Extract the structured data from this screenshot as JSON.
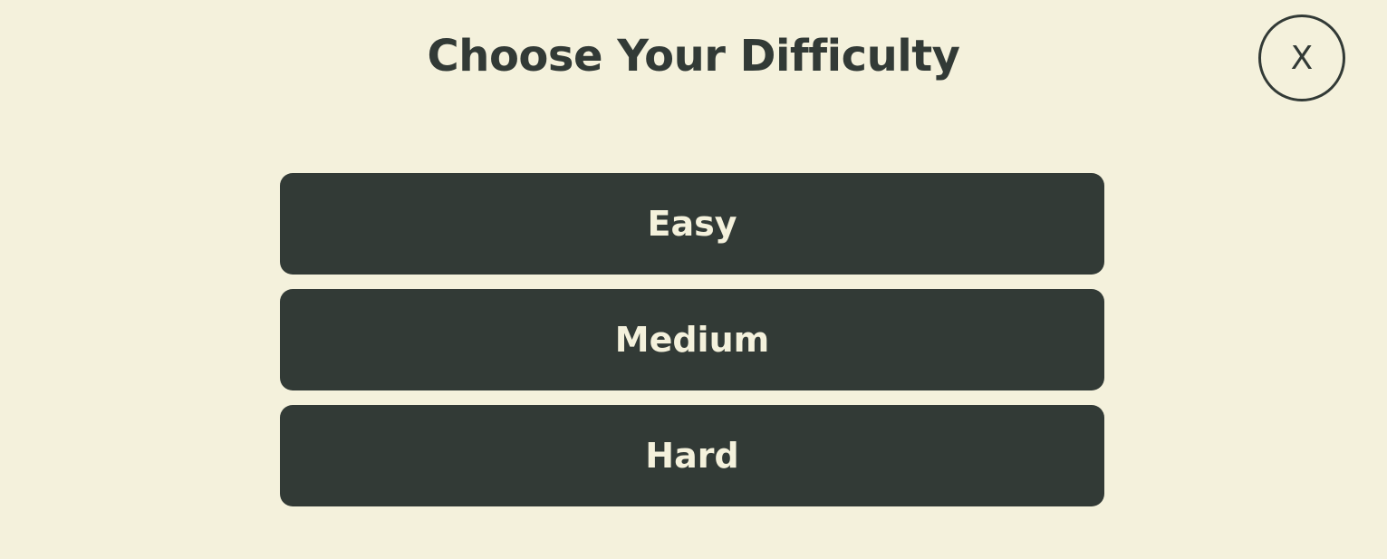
{
  "dialog": {
    "title": "Choose Your Difficulty",
    "close_label": "X",
    "options": [
      {
        "label": "Easy"
      },
      {
        "label": "Medium"
      },
      {
        "label": "Hard"
      }
    ]
  },
  "colors": {
    "background": "#f4f1dc",
    "button_fill": "#323a36",
    "button_text": "#f4f1dc",
    "heading_text": "#323a36"
  }
}
